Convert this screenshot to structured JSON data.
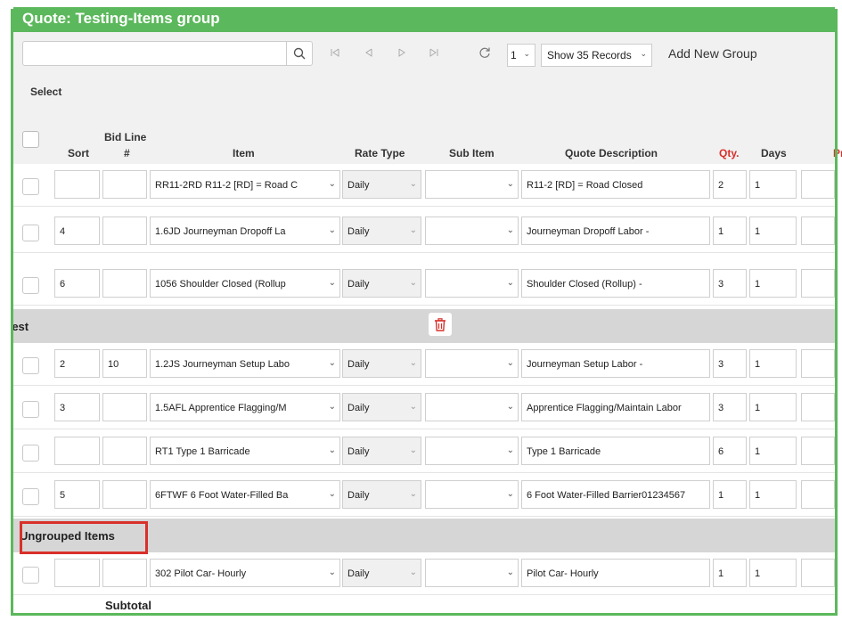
{
  "title": "Quote: Testing-Items group",
  "toolbar": {
    "search_placeholder": "",
    "page_value": "1",
    "records_value": "Show 35 Records",
    "add_group": "Add New Group"
  },
  "header": {
    "select": "Select",
    "sort": "Sort",
    "bid_line": "Bid Line",
    "bid_line_hash": "#",
    "item": "Item",
    "rate_type": "Rate Type",
    "sub_item": "Sub Item",
    "quote_description": "Quote Description",
    "qty": "Qty.",
    "days": "Days",
    "pr": "Pr"
  },
  "rows_group1": [
    {
      "sort": "",
      "bid": "",
      "item": "RR11-2RD   R11-2 [RD] = Road C",
      "rate": "Daily",
      "sub": "",
      "desc": "R11-2 [RD] = Road Closed",
      "qty": "2",
      "days": "1"
    },
    {
      "sort": "4",
      "bid": "",
      "item": "1.6JD      Journeyman Dropoff La",
      "rate": "Daily",
      "sub": "",
      "desc": "Journeyman Dropoff Labor -",
      "qty": "1",
      "days": "1"
    },
    {
      "sort": "6",
      "bid": "",
      "item": "1056       Shoulder Closed (Rollup",
      "rate": "Daily",
      "sub": "",
      "desc": "Shoulder Closed (Rollup) -",
      "qty": "3",
      "days": "1"
    }
  ],
  "group_test": "test",
  "rows_group2": [
    {
      "sort": "2",
      "bid": "10",
      "item": "1.2JS      Journeyman Setup Labo",
      "rate": "Daily",
      "sub": "",
      "desc": "Journeyman Setup Labor -",
      "qty": "3",
      "days": "1"
    },
    {
      "sort": "3",
      "bid": "",
      "item": "1.5AFL    Apprentice Flagging/M",
      "rate": "Daily",
      "sub": "",
      "desc": "Apprentice Flagging/Maintain Labor",
      "qty": "3",
      "days": "1"
    },
    {
      "sort": "",
      "bid": "",
      "item": "RT1       Type 1 Barricade",
      "rate": "Daily",
      "sub": "",
      "desc": "Type 1 Barricade",
      "qty": "6",
      "days": "1"
    },
    {
      "sort": "5",
      "bid": "",
      "item": "6FTWF     6 Foot Water-Filled Ba",
      "rate": "Daily",
      "sub": "",
      "desc": "6 Foot Water-Filled Barrier01234567",
      "qty": "1",
      "days": "1"
    }
  ],
  "group_ungrouped": "Ungrouped Items",
  "rows_group3": [
    {
      "sort": "",
      "bid": "",
      "item": "302       Pilot Car- Hourly",
      "rate": "Daily",
      "sub": "",
      "desc": "Pilot Car- Hourly",
      "qty": "1",
      "days": "1"
    }
  ],
  "subtotal": "Subtotal",
  "colors": {
    "accent": "#5cb85c",
    "danger": "#d9302a"
  }
}
